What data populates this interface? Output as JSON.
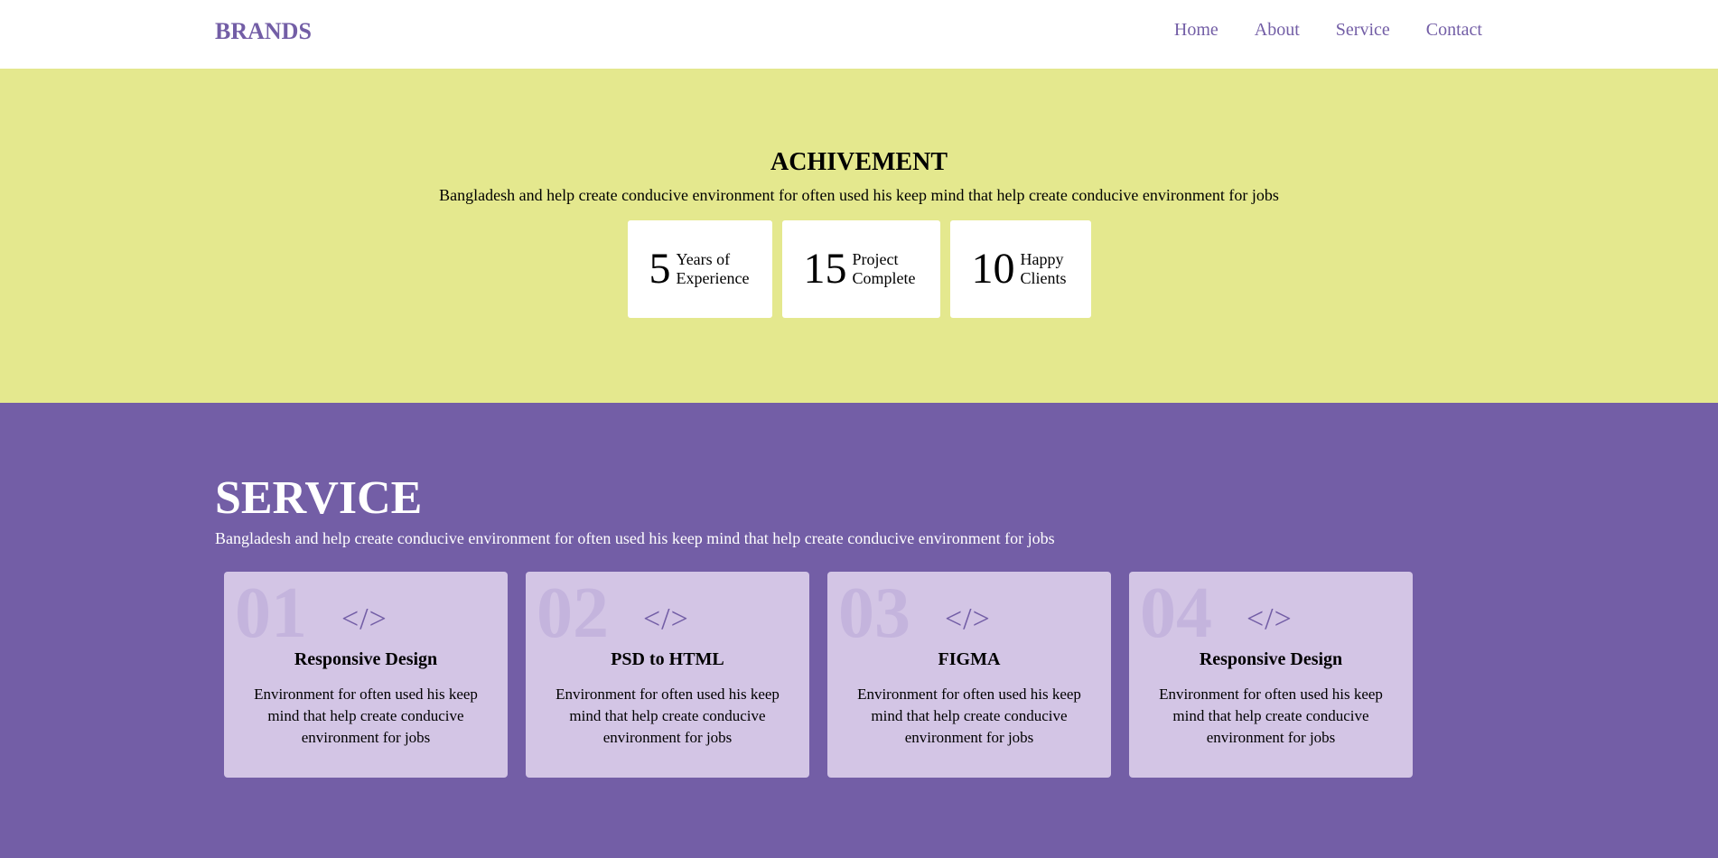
{
  "header": {
    "brand": "BRANDS",
    "nav": [
      "Home",
      "About",
      "Service",
      "Contact"
    ]
  },
  "achievement": {
    "title": "ACHIVEMENT",
    "description": "Bangladesh and help create conducive environment for often used his keep mind that help create conducive environment for jobs",
    "stats": [
      {
        "number": "5",
        "label_line1": "Years of",
        "label_line2": "Experience"
      },
      {
        "number": "15",
        "label_line1": "Project",
        "label_line2": "Complete"
      },
      {
        "number": "10",
        "label_line1": "Happy",
        "label_line2": "Clients"
      }
    ]
  },
  "service": {
    "title": "SERVICE",
    "description": "Bangladesh and help create conducive environment for often used his keep mind that help create conducive environment for jobs",
    "cards": [
      {
        "number": "01",
        "icon": "</>",
        "title": "Responsive Design",
        "text": "Environment for often used his keep mind that help create conducive environment for jobs"
      },
      {
        "number": "02",
        "icon": "</>",
        "title": "PSD to HTML",
        "text": "Environment for often used his keep mind that help create conducive environment for jobs"
      },
      {
        "number": "03",
        "icon": "</>",
        "title": "FIGMA",
        "text": "Environment for often used his keep mind that help create conducive environment for jobs"
      },
      {
        "number": "04",
        "icon": "</>",
        "title": "Responsive Design",
        "text": "Environment for often used his keep mind that help create conducive environment for jobs"
      }
    ]
  },
  "colors": {
    "brand_purple": "#735ea6",
    "achievement_bg": "#e4e88e",
    "card_bg": "#d3c5e5",
    "card_number": "#c4b4dd"
  }
}
